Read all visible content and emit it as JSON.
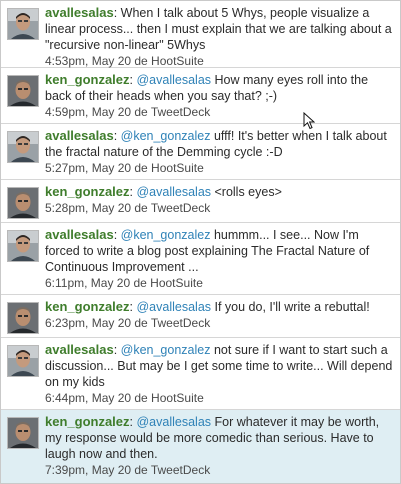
{
  "tweets": [
    {
      "user": "avallesalas",
      "mention": "",
      "text_before": "",
      "text": "When I talk about 5 Whys, people visualize a linear process... then I must explain that we are talking about a \"recursive non-linear\" 5Whys",
      "meta": "4:53pm, May 20 de HootSuite"
    },
    {
      "user": "ken_gonzalez",
      "mention": "@avallesalas",
      "text": " How many eyes roll into the back of their heads when you say that? ;-)",
      "meta": "4:59pm, May 20 de TweetDeck"
    },
    {
      "user": "avallesalas",
      "mention": "@ken_gonzalez",
      "text": " ufff! It's better when I talk about the fractal nature of the Demming cycle :-D",
      "meta": "5:27pm, May 20 de HootSuite"
    },
    {
      "user": "ken_gonzalez",
      "mention": "@avallesalas",
      "text": " <rolls eyes>",
      "meta": "5:28pm, May 20 de TweetDeck"
    },
    {
      "user": "avallesalas",
      "mention": "@ken_gonzalez",
      "text": " hummm... I see... Now I'm forced to write a blog post explaining The Fractal Nature of Continuous Improvement ...",
      "meta": "6:11pm, May 20 de HootSuite"
    },
    {
      "user": "ken_gonzalez",
      "mention": "@avallesalas",
      "text": " If you do, I'll write a rebuttal!",
      "meta": "6:23pm, May 20 de TweetDeck"
    },
    {
      "user": "avallesalas",
      "mention": "@ken_gonzalez",
      "text": " not sure if I want to start such a discussion... But may be I get some time to write... Will depend on my kids",
      "meta": "6:44pm, May 20 de HootSuite"
    },
    {
      "user": "ken_gonzalez",
      "mention": "@avallesalas",
      "text": " For whatever it may be worth, my response would be more comedic than serious. Have to laugh now and then.",
      "meta": "7:39pm, May 20 de TweetDeck"
    }
  ],
  "colors": {
    "username": "#3f7d2c",
    "mention": "#2f82b7",
    "highlight_row": "#dfeef3"
  },
  "icons": {
    "avallesalas": "person-photo-avatar",
    "ken_gonzalez": "person-photo-avatar",
    "cursor": "mouse-pointer-icon"
  }
}
